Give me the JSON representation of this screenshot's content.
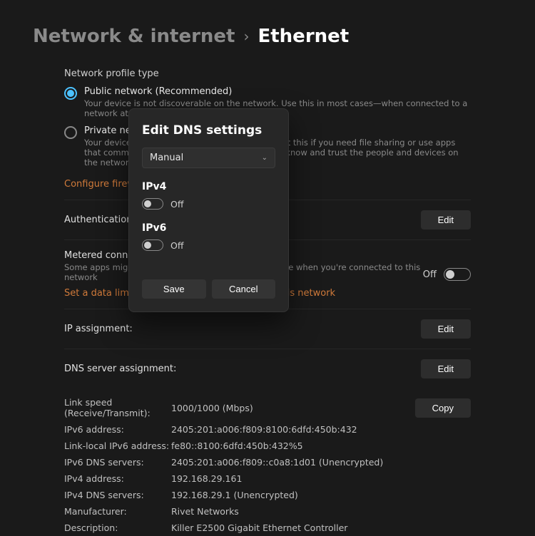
{
  "breadcrumb": {
    "parent": "Network & internet",
    "sep": "›",
    "current": "Ethernet"
  },
  "profile": {
    "title": "Network profile type",
    "public": {
      "label": "Public network (Recommended)",
      "desc": "Your device is not discoverable on the network. Use this in most cases—when connected to a network at home, work, or in a public place."
    },
    "private": {
      "label": "Private network",
      "desc": "Your device is discoverable on the network. Select this if you need file sharing or use apps that communicate over this network. You should know and trust the people and devices on the network."
    },
    "firewall_link": "Configure firewall and security settings"
  },
  "rows": {
    "auth": {
      "title": "Authentication settings",
      "button": "Edit"
    },
    "metered": {
      "title": "Metered connection",
      "desc": "Some apps might work differently to reduce data usage when you're connected to this network",
      "state": "Off",
      "link": "Set a data limit to help control data usage on this network"
    },
    "ip": {
      "title": "IP assignment:",
      "button": "Edit"
    },
    "dns": {
      "title": "DNS server assignment:",
      "button": "Edit"
    },
    "copy": "Copy"
  },
  "details": [
    {
      "label": "Link speed (Receive/Transmit):",
      "value": "1000/1000 (Mbps)"
    },
    {
      "label": "IPv6 address:",
      "value": "2405:201:a006:f809:8100:6dfd:450b:432"
    },
    {
      "label": "Link-local IPv6 address:",
      "value": "fe80::8100:6dfd:450b:432%5"
    },
    {
      "label": "IPv6 DNS servers:",
      "value": "2405:201:a006:f809::c0a8:1d01 (Unencrypted)"
    },
    {
      "label": "IPv4 address:",
      "value": "192.168.29.161"
    },
    {
      "label": "IPv4 DNS servers:",
      "value": "192.168.29.1 (Unencrypted)"
    },
    {
      "label": "Manufacturer:",
      "value": "Rivet Networks"
    },
    {
      "label": "Description:",
      "value": "Killer E2500 Gigabit Ethernet Controller"
    }
  ],
  "dialog": {
    "title": "Edit DNS settings",
    "mode": "Manual",
    "ipv4": {
      "title": "IPv4",
      "state": "Off"
    },
    "ipv6": {
      "title": "IPv6",
      "state": "Off"
    },
    "save": "Save",
    "cancel": "Cancel"
  }
}
